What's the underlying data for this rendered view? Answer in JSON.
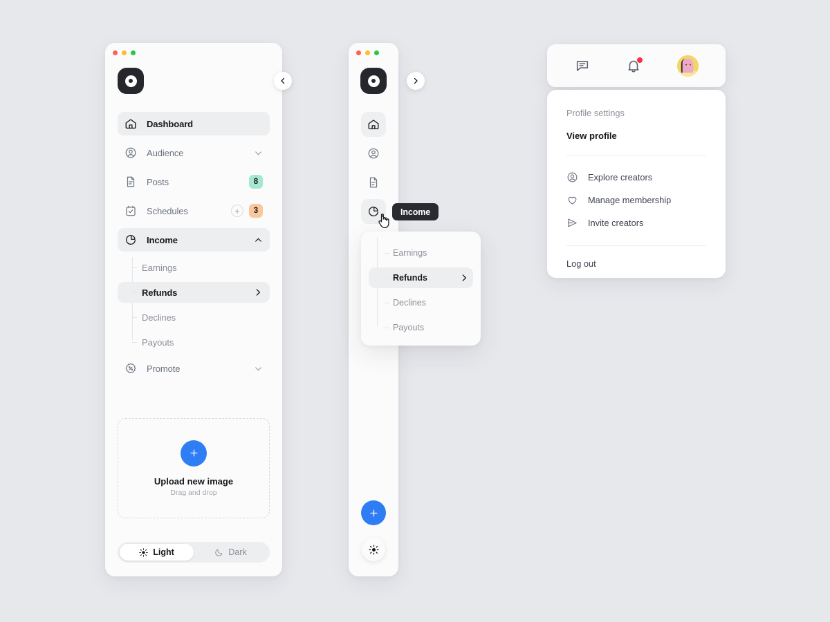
{
  "window": {
    "traffic_lights": [
      "#ff5f57",
      "#febc2e",
      "#28c840"
    ]
  },
  "colors": {
    "page_bg": "#e7e8ec",
    "panel_bg": "#fbfbfb",
    "accent_blue": "#2f7df4",
    "badge_green": "#a5e7cf",
    "badge_orange": "#f9c79d",
    "notification_red": "#f5333f",
    "tooltip_bg": "#2a2b30"
  },
  "sidebar_expanded": {
    "logo_name": "app-logo",
    "collapse_button": "chevron-left-icon",
    "nav": [
      {
        "id": "dashboard",
        "label": "Dashboard",
        "icon": "home-icon",
        "active": true
      },
      {
        "id": "audience",
        "label": "Audience",
        "icon": "user-circle-icon",
        "chevron": "chevron-down-icon"
      },
      {
        "id": "posts",
        "label": "Posts",
        "icon": "document-icon",
        "badge": "8",
        "badge_color": "#a5e7cf"
      },
      {
        "id": "schedules",
        "label": "Schedules",
        "icon": "calendar-check-icon",
        "add": "+",
        "badge": "3",
        "badge_color": "#f9c79d"
      },
      {
        "id": "income",
        "label": "Income",
        "icon": "pie-chart-icon",
        "chevron": "chevron-up-icon",
        "expanded": true
      },
      {
        "id": "promote",
        "label": "Promote",
        "icon": "percent-badge-icon",
        "chevron": "chevron-down-icon"
      }
    ],
    "income_sub": [
      {
        "id": "earnings",
        "label": "Earnings"
      },
      {
        "id": "refunds",
        "label": "Refunds",
        "active": true,
        "arrow": "chevron-right-icon"
      },
      {
        "id": "declines",
        "label": "Declines"
      },
      {
        "id": "payouts",
        "label": "Payouts"
      }
    ],
    "upload": {
      "button_icon": "plus-icon",
      "title": "Upload new image",
      "subtitle": "Drag and drop"
    },
    "theme_toggle": {
      "light_label": "Light",
      "light_icon": "sun-icon",
      "dark_label": "Dark",
      "dark_icon": "moon-icon",
      "selected": "Light"
    }
  },
  "sidebar_collapsed": {
    "logo_name": "app-logo",
    "expand_button": "chevron-right-icon",
    "rail": [
      {
        "id": "dashboard",
        "icon": "home-icon",
        "active": true
      },
      {
        "id": "audience",
        "icon": "user-circle-icon"
      },
      {
        "id": "posts",
        "icon": "document-icon"
      },
      {
        "id": "income",
        "icon": "pie-chart-icon",
        "active": true
      }
    ],
    "fab_icon": "plus-icon",
    "theme_icon": "sun-icon",
    "tooltip": "Income",
    "flyout": [
      {
        "id": "earnings",
        "label": "Earnings"
      },
      {
        "id": "refunds",
        "label": "Refunds",
        "active": true,
        "arrow": "chevron-right-icon"
      },
      {
        "id": "declines",
        "label": "Declines"
      },
      {
        "id": "payouts",
        "label": "Payouts"
      }
    ]
  },
  "profile": {
    "topbar": {
      "messages_icon": "chat-bubble-icon",
      "notifications_icon": "bell-icon",
      "has_notification": true,
      "avatar_name": "user-avatar"
    },
    "menu": {
      "section_label": "Profile settings",
      "view_profile": "View profile",
      "items": [
        {
          "id": "explore",
          "label": "Explore creators",
          "icon": "user-circle-icon"
        },
        {
          "id": "membership",
          "label": "Manage membership",
          "icon": "heart-icon"
        },
        {
          "id": "invite",
          "label": "Invite creators",
          "icon": "send-icon"
        }
      ],
      "logout": "Log out"
    }
  }
}
